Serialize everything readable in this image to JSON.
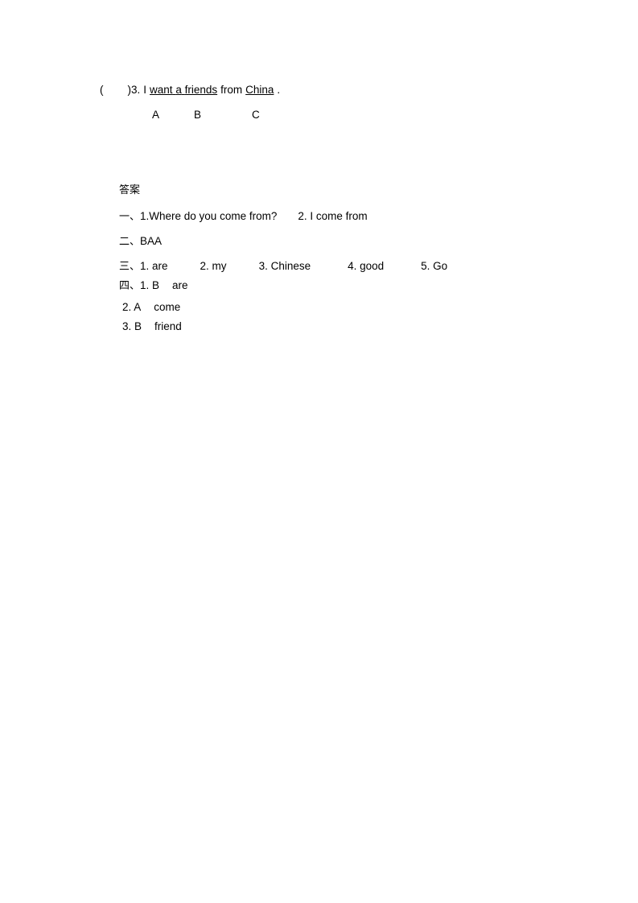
{
  "question": {
    "paren": "(",
    "number": ")3.",
    "text_before": "I",
    "underlined_1": "want",
    "mid_1": "a",
    "underlined_2": "friends",
    "mid_2": "from",
    "underlined_3": "China",
    "period": ".",
    "options": [
      "A",
      "B",
      "C"
    ]
  },
  "answers": {
    "title": "答案",
    "rows": [
      {
        "label": "一、",
        "items": [
          "1.Where do you come from?",
          "2. I come from"
        ]
      },
      {
        "label": "二、",
        "items": [
          "BAA"
        ]
      },
      {
        "label": "三、",
        "items": [
          "1. are",
          "2. my",
          "3. Chinese",
          "4. good",
          "5. Go"
        ]
      },
      {
        "label": "四、",
        "items": [
          "1.  B",
          "are"
        ]
      },
      {
        "label": "",
        "items": [
          "2.  A",
          "come"
        ]
      },
      {
        "label": "",
        "items": [
          "3.  B",
          "friend"
        ]
      }
    ]
  }
}
